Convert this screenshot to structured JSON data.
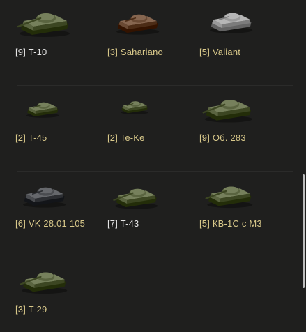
{
  "colors": {
    "background": "#1f1f1e",
    "white_label": "#e6e6e6",
    "premium_label": "#d8c88a",
    "tank_green": "#5a6440",
    "tank_brown": "#6a4a34",
    "tank_gray": "#9a9a9a",
    "tank_dark": "#4a4c50"
  },
  "tanks": [
    {
      "tier": "[9]",
      "name": "T-10",
      "label_color": "white",
      "hull": "green",
      "icon": "heavy-tank-icon"
    },
    {
      "tier": "[3]",
      "name": "Sahariano",
      "label_color": "premium",
      "hull": "brown",
      "icon": "light-tank-icon"
    },
    {
      "tier": "[5]",
      "name": "Valiant",
      "label_color": "premium",
      "hull": "gray",
      "icon": "infantry-tank-icon"
    },
    {
      "tier": "[2]",
      "name": "T-45",
      "label_color": "premium",
      "hull": "green",
      "icon": "light-tank-icon"
    },
    {
      "tier": "[2]",
      "name": "Te-Ke",
      "label_color": "premium",
      "hull": "green",
      "icon": "tankette-icon"
    },
    {
      "tier": "[9]",
      "name": "Об. 283",
      "label_color": "premium",
      "hull": "green",
      "icon": "medium-tank-icon"
    },
    {
      "tier": "[6]",
      "name": "VK 28.01 105",
      "label_color": "premium",
      "hull": "dark",
      "icon": "light-tank-icon"
    },
    {
      "tier": "[7]",
      "name": "T-43",
      "label_color": "white",
      "hull": "green",
      "icon": "medium-tank-icon"
    },
    {
      "tier": "[5]",
      "name": "КВ-1С с М3",
      "label_color": "premium",
      "hull": "green",
      "icon": "heavy-tank-icon"
    },
    {
      "tier": "[3]",
      "name": "T-29",
      "label_color": "premium",
      "hull": "green",
      "icon": "heavy-tank-icon"
    }
  ]
}
